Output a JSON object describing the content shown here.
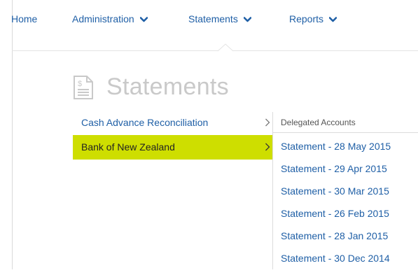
{
  "nav": {
    "home": "Home",
    "administration": "Administration",
    "statements": "Statements",
    "reports": "Reports"
  },
  "heading": {
    "title": "Statements",
    "icon": "document-dollar-icon"
  },
  "menu": {
    "items": [
      {
        "label": "Cash Advance Reconciliation",
        "selected": false
      },
      {
        "label": "Bank of New Zealand",
        "selected": true
      }
    ]
  },
  "panel": {
    "heading": "Delegated Accounts",
    "statements": [
      "Statement - 28 May 2015",
      "Statement - 29 Apr 2015",
      "Statement - 30 Mar 2015",
      "Statement - 26 Feb 2015",
      "Statement - 28 Jan 2015",
      "Statement - 30 Dec 2014"
    ]
  },
  "colors": {
    "link": "#1f5fa6",
    "selected_bg": "#cede00",
    "heading_gray": "#c9c9c9"
  }
}
